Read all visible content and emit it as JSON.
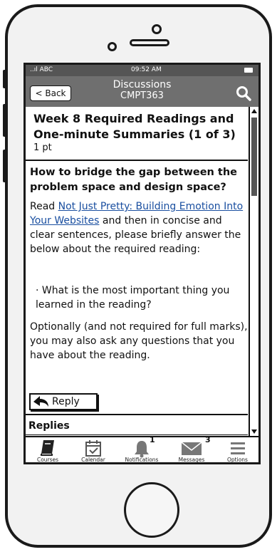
{
  "status_bar": {
    "carrier": "..ıl ABC",
    "time": "09:52 AM"
  },
  "nav": {
    "back_label": "< Back",
    "title": "Discussions",
    "subtitle": "CMPT363"
  },
  "post": {
    "title": "Week 8 Required Readings and One-minute Summaries (1 of 3)",
    "points": "1 pt",
    "question": "How to bridge the gap between the problem space and design space?",
    "intro_before_link": "Read ",
    "link_text": "Not Just Pretty: Building Emotion Into Your Websites",
    "intro_after_link": " and then in concise and clear sentences, please briefly answer the below about the required reading:",
    "bullet": "· What is the most important thing you learned in the reading?",
    "optional_note": "Optionally (and not required for full marks), you may also ask any questions that you have about the reading.",
    "reply_label": "Reply",
    "replies_heading": "Replies"
  },
  "tabbar": {
    "items": [
      {
        "label": "Courses",
        "icon": "book-icon"
      },
      {
        "label": "Calendar",
        "icon": "calendar-icon"
      },
      {
        "label": "Notifications",
        "icon": "bell-icon",
        "badge": "1"
      },
      {
        "label": "Messages",
        "icon": "envelope-icon",
        "badge": "3"
      },
      {
        "label": "Options",
        "icon": "menu-icon"
      }
    ]
  },
  "colors": {
    "status_bar": "#555555",
    "nav_bar": "#6f6f6f",
    "link": "#1a4fa0"
  }
}
